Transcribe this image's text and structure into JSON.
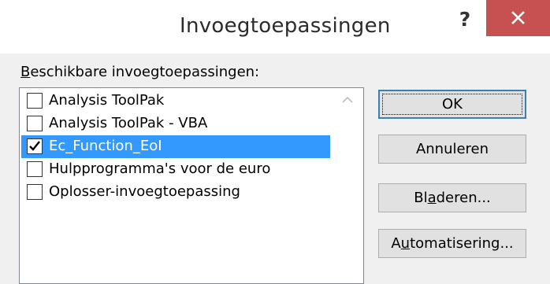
{
  "window": {
    "title": "Invoegtoepassingen",
    "help_label": "?",
    "colors": {
      "close_bg": "#c75050",
      "selection": "#3399ff"
    }
  },
  "list": {
    "label_prefix": "",
    "label_mnemonic": "B",
    "label_rest": "eschikbare invoegtoepassingen:",
    "items": [
      {
        "label": "Analysis ToolPak",
        "checked": false,
        "selected": false
      },
      {
        "label": "Analysis ToolPak - VBA",
        "checked": false,
        "selected": false
      },
      {
        "label": "Ec_Function_EoI",
        "checked": true,
        "selected": true
      },
      {
        "label": "Hulpprogramma's voor de euro",
        "checked": false,
        "selected": false
      },
      {
        "label": "Oplosser-invoegtoepassing",
        "checked": false,
        "selected": false
      }
    ]
  },
  "buttons": {
    "ok": {
      "label": "OK"
    },
    "cancel": {
      "label": "Annuleren"
    },
    "browse": {
      "pre": "Bl",
      "mnemonic": "a",
      "post": "deren..."
    },
    "automation": {
      "pre": "A",
      "mnemonic": "u",
      "post": "tomatisering..."
    }
  }
}
